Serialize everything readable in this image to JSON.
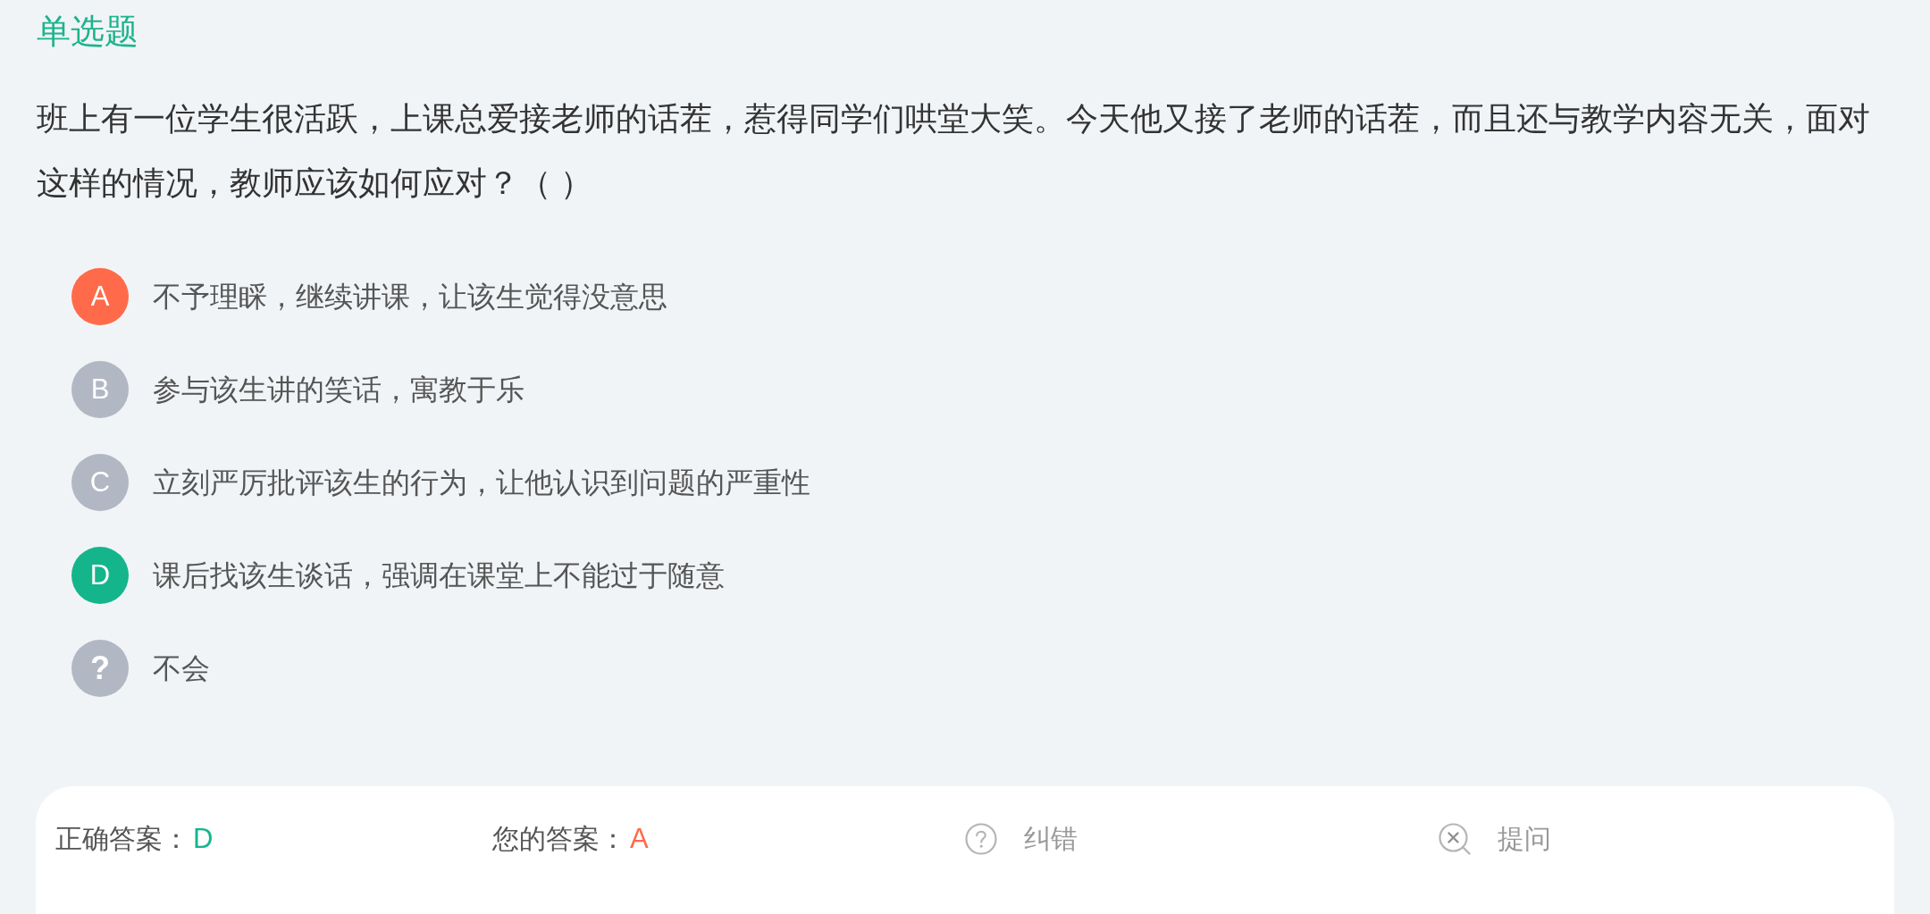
{
  "question_type": "单选题",
  "question": "班上有一位学生很活跃，上课总爱接老师的话茬，惹得同学们哄堂大笑。今天他又接了老师的话茬，而且还与教学内容无关，面对这样的情况，教师应该如何应对？（ ）",
  "options": [
    {
      "kind": "choice",
      "letter": "A",
      "text": "不予理睬，继续讲课，让该生觉得没意思",
      "selected": true,
      "correct": false
    },
    {
      "kind": "choice",
      "letter": "B",
      "text": "参与该生讲的笑话，寓教于乐",
      "selected": false,
      "correct": false
    },
    {
      "kind": "choice",
      "letter": "C",
      "text": "立刻严厉批评该生的行为，让他认识到问题的严重性",
      "selected": false,
      "correct": false
    },
    {
      "kind": "choice",
      "letter": "D",
      "text": "课后找该生谈话，强调在课堂上不能过于随意",
      "selected": false,
      "correct": true
    },
    {
      "kind": "unsure",
      "letter": "?",
      "text": "不会",
      "selected": false,
      "correct": false
    }
  ],
  "answer_bar": {
    "answers": [
      {
        "kind": "correct",
        "label": "正确答案：",
        "value": "D"
      },
      {
        "kind": "yours",
        "label": "您的答案：",
        "value": "A"
      }
    ],
    "actions": [
      {
        "kind": "report",
        "label": "纠错"
      },
      {
        "kind": "ask",
        "label": "提问"
      }
    ]
  }
}
